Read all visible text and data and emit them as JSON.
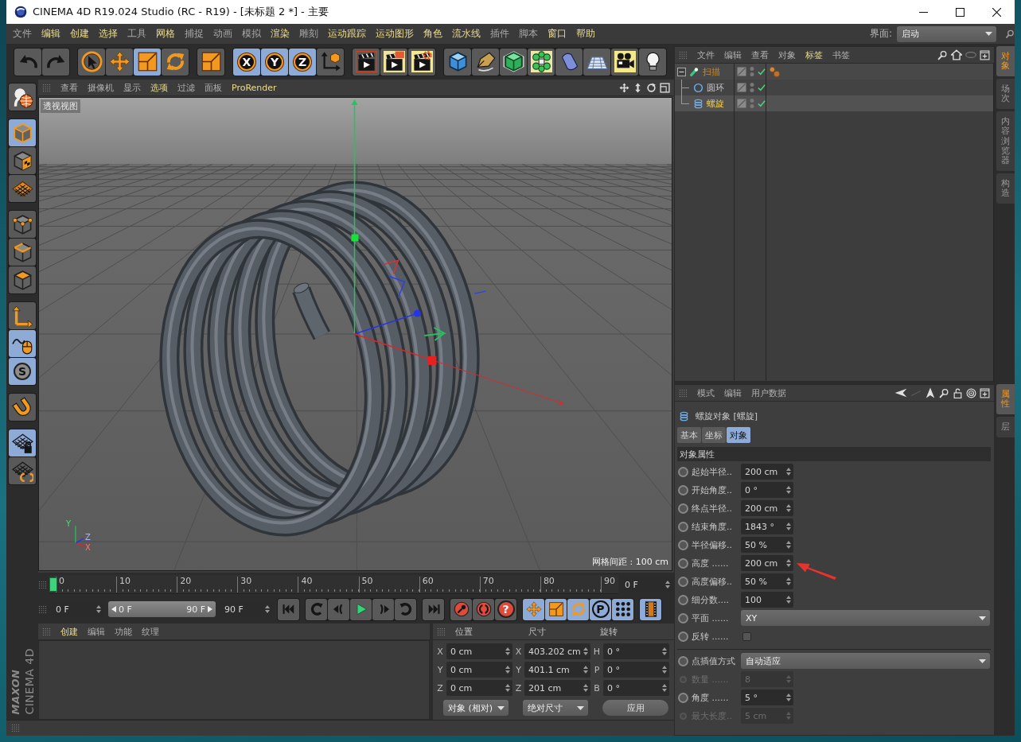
{
  "window": {
    "title": "CINEMA 4D R19.024 Studio (RC - R19) - [未标题 2 *] - 主要"
  },
  "menu_bar": {
    "items": [
      {
        "label": "文件",
        "highlighted": false
      },
      {
        "label": "编辑",
        "highlighted": true
      },
      {
        "label": "创建",
        "highlighted": true
      },
      {
        "label": "选择",
        "highlighted": true
      },
      {
        "label": "工具",
        "highlighted": false
      },
      {
        "label": "网格",
        "highlighted": true
      },
      {
        "label": "捕捉",
        "highlighted": false
      },
      {
        "label": "动画",
        "highlighted": false
      },
      {
        "label": "模拟",
        "highlighted": false
      },
      {
        "label": "渲染",
        "highlighted": true
      },
      {
        "label": "雕刻",
        "highlighted": false
      },
      {
        "label": "运动跟踪",
        "highlighted": true
      },
      {
        "label": "运动图形",
        "highlighted": true
      },
      {
        "label": "角色",
        "highlighted": true
      },
      {
        "label": "流水线",
        "highlighted": true
      },
      {
        "label": "插件",
        "highlighted": false
      },
      {
        "label": "脚本",
        "highlighted": false
      },
      {
        "label": "窗口",
        "highlighted": true
      },
      {
        "label": "帮助",
        "highlighted": true
      }
    ],
    "layout_label": "界面:",
    "layout_value": "启动"
  },
  "toolbar": {
    "groups": [
      {
        "buttons": [
          {
            "active": false
          },
          {
            "active": false
          }
        ]
      },
      {
        "buttons": [
          {
            "active": false
          },
          {
            "active": false
          },
          {
            "active": true
          },
          {
            "active": false
          }
        ]
      },
      {
        "buttons": [
          {
            "active": false
          }
        ]
      },
      {
        "buttons": [
          {
            "active": true,
            "label": "X"
          },
          {
            "active": true,
            "label": "Y"
          },
          {
            "active": true,
            "label": "Z"
          },
          {
            "active": false
          }
        ]
      },
      {
        "buttons": [
          {
            "active": false
          },
          {
            "active": false
          },
          {
            "active": false
          }
        ]
      },
      {
        "buttons": [
          {
            "active": false
          },
          {
            "active": false
          },
          {
            "active": false
          },
          {
            "active": false
          },
          {
            "active": false
          },
          {
            "active": false
          },
          {
            "active": false
          },
          {
            "active": false
          }
        ]
      }
    ]
  },
  "side_toolbar": {
    "groups": [
      {
        "buttons": [
          {
            "active": false
          }
        ]
      },
      {
        "buttons": [
          {
            "active": true
          },
          {
            "active": false
          },
          {
            "active": false
          }
        ]
      },
      {
        "buttons": [
          {
            "active": false
          },
          {
            "active": false
          },
          {
            "active": false
          }
        ]
      },
      {
        "buttons": [
          {
            "active": false
          },
          {
            "active": true
          },
          {
            "active": true,
            "label": "S"
          }
        ]
      },
      {
        "buttons": [
          {
            "active": false
          }
        ]
      },
      {
        "buttons": [
          {
            "active": true
          },
          {
            "active": false
          }
        ]
      }
    ]
  },
  "viewport": {
    "menu": [
      {
        "label": "查看",
        "highlighted": false
      },
      {
        "label": "摄像机",
        "highlighted": false
      },
      {
        "label": "显示",
        "highlighted": false
      },
      {
        "label": "选项",
        "highlighted": true
      },
      {
        "label": "过滤",
        "highlighted": false
      },
      {
        "label": "面板",
        "highlighted": false
      },
      {
        "label": "ProRender",
        "highlighted": true
      }
    ],
    "camera": "透视视图",
    "grid_spacing": "网格间距 : 100 cm",
    "axis_labels": {
      "y": "Y",
      "z": "Z",
      "x": "X"
    }
  },
  "timeline": {
    "ticks": [
      "0",
      "10",
      "20",
      "30",
      "40",
      "50",
      "60",
      "70",
      "80",
      "90"
    ],
    "level": 0,
    "current_frame": "0 F"
  },
  "playback": {
    "start": "0 F",
    "range": {
      "from": "0 F",
      "to": "90 F",
      "level": 1
    },
    "end": "90 F",
    "groups": [
      {
        "buttons": [
          {
            "active": false
          }
        ]
      },
      {
        "buttons": [
          {
            "active": false
          },
          {
            "active": false
          },
          {
            "active": false
          },
          {
            "active": false
          },
          {
            "active": false
          }
        ]
      },
      {
        "buttons": [
          {
            "active": false
          }
        ]
      },
      {
        "buttons": [
          {
            "active": false
          },
          {
            "active": false
          },
          {
            "active": false,
            "label": "?"
          }
        ]
      },
      {
        "buttons": [
          {
            "active": true
          },
          {
            "active": true
          },
          {
            "active": true
          },
          {
            "active": true,
            "label": "P"
          },
          {
            "active": true
          }
        ]
      },
      {
        "buttons": [
          {
            "active": true
          }
        ]
      }
    ]
  },
  "material_manager": {
    "menu": [
      {
        "label": "创建",
        "highlighted": true
      },
      {
        "label": "编辑",
        "highlighted": false
      },
      {
        "label": "功能",
        "highlighted": false
      },
      {
        "label": "纹理",
        "highlighted": false
      }
    ]
  },
  "coordinates": {
    "headers": [
      "位置",
      "尺寸",
      "旋转"
    ],
    "rows": [
      {
        "position_axis": "X",
        "position": "0 cm",
        "size_axis": "X",
        "size": "403.202 cm",
        "rotation_axis": "H",
        "rotation": "0 °"
      },
      {
        "position_axis": "Y",
        "position": "0 cm",
        "size_axis": "Y",
        "size": "401.1 cm",
        "rotation_axis": "P",
        "rotation": "0 °"
      },
      {
        "position_axis": "Z",
        "position": "0 cm",
        "size_axis": "Z",
        "size": "201 cm",
        "rotation_axis": "B",
        "rotation": "0 °"
      }
    ],
    "space": "对象 (相对)",
    "size_mode": "绝对尺寸",
    "apply": "应用"
  },
  "logo": {
    "brand": "MAXON",
    "product": "CINEMA 4D"
  },
  "object_manager": {
    "menu": [
      {
        "label": "文件",
        "highlighted": false
      },
      {
        "label": "编辑",
        "highlighted": false
      },
      {
        "label": "查看",
        "highlighted": false
      },
      {
        "label": "对象",
        "highlighted": false
      },
      {
        "label": "标签",
        "highlighted": true
      },
      {
        "label": "书签",
        "highlighted": false
      }
    ],
    "objects": [
      {
        "name": "扫描",
        "kind": "sweep",
        "expanded": true,
        "selected": false,
        "emphasized": true,
        "enabled": true,
        "tags": [
          {
            "kind": "phong"
          }
        ],
        "children": [
          {
            "name": "圆环",
            "kind": "circle",
            "selected": false,
            "emphasized": false,
            "enabled": true
          },
          {
            "name": "螺旋",
            "kind": "helix",
            "selected": true,
            "emphasized": false,
            "enabled": true
          }
        ]
      }
    ],
    "side_tabs": [
      {
        "label": "对象",
        "selected": true
      },
      {
        "label": "场次",
        "selected": false
      },
      {
        "label": "内容浏览器",
        "selected": false
      },
      {
        "label": "构造",
        "selected": false
      }
    ]
  },
  "attributes": {
    "menu": [
      {
        "label": "模式",
        "highlighted": false
      },
      {
        "label": "编辑",
        "highlighted": false
      },
      {
        "label": "用户数据",
        "highlighted": false
      }
    ],
    "title": "螺旋对象 [螺旋]",
    "tabs": [
      {
        "label": "基本",
        "selected": false
      },
      {
        "label": "坐标",
        "selected": false
      },
      {
        "label": "对象",
        "selected": true
      }
    ],
    "section": "对象属性",
    "fields": [
      {
        "kind": "number",
        "label": "起始半径..",
        "value": "200 cm",
        "disabled": false
      },
      {
        "kind": "number",
        "label": "开始角度..",
        "value": "0 °",
        "disabled": false
      },
      {
        "kind": "number",
        "label": "终点半径..",
        "value": "200 cm",
        "disabled": false
      },
      {
        "kind": "number",
        "label": "结束角度..",
        "value": "1843 °",
        "disabled": false
      },
      {
        "kind": "number",
        "label": "半径偏移..",
        "value": "50 %",
        "disabled": false
      },
      {
        "kind": "number",
        "label": "高度 ......",
        "value": "200 cm",
        "disabled": false
      },
      {
        "kind": "number",
        "label": "高度偏移..",
        "value": "50 %",
        "disabled": false
      },
      {
        "kind": "number",
        "label": "细分数....",
        "value": "100",
        "disabled": false
      },
      {
        "kind": "dropdown",
        "label": "平面 ......",
        "value": "XY",
        "disabled": false
      },
      {
        "kind": "checkbox",
        "label": "反转 ......",
        "checked": false,
        "disabled": false
      }
    ],
    "interpolation_fields": [
      {
        "kind": "dropdown",
        "label": "点插值方式",
        "value": "自动适应",
        "disabled": false
      },
      {
        "kind": "number",
        "label": "数量 ......",
        "value": "8",
        "disabled": true
      },
      {
        "kind": "number",
        "label": "角度 ......",
        "value": "5 °",
        "disabled": false
      },
      {
        "kind": "number",
        "label": "最大长度..",
        "value": "5 cm",
        "disabled": true
      }
    ],
    "side_tabs": [
      {
        "label": "属性",
        "selected": true
      },
      {
        "label": "层",
        "selected": false
      }
    ]
  }
}
